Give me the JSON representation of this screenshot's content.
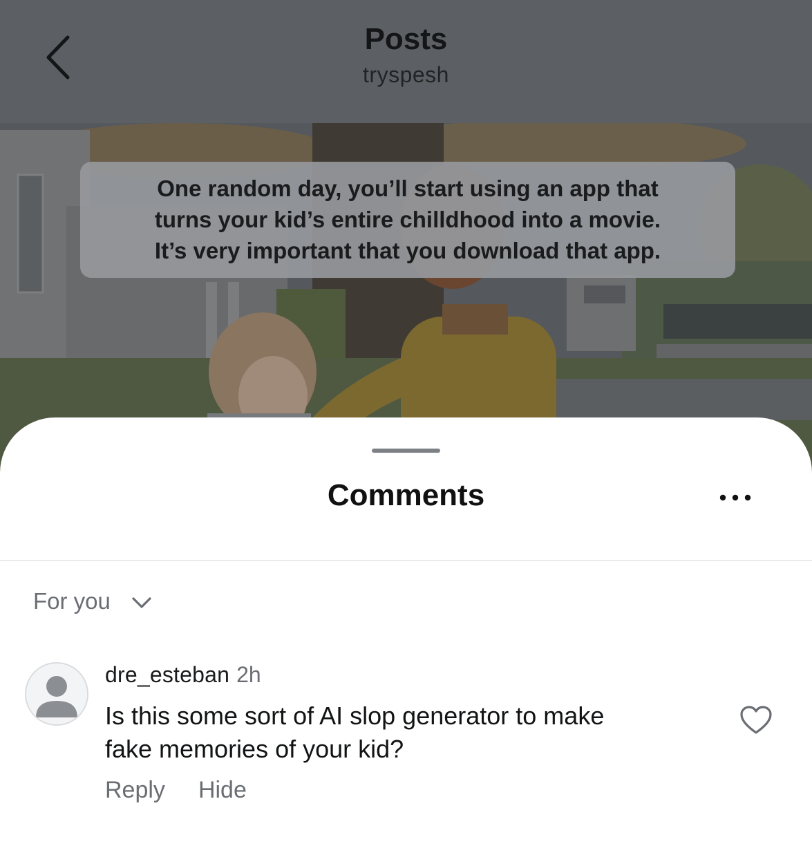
{
  "header": {
    "title": "Posts",
    "subtitle": "tryspesh",
    "back_icon": "chevron-left-icon"
  },
  "post": {
    "caption_lines": [
      "One random day, you’ll start using an app that",
      "turns your kid’s entire chilldhood into a movie.",
      "It’s very important that you download that app."
    ]
  },
  "comments_sheet": {
    "title": "Comments",
    "more_icon": "more-dots-icon",
    "sort_label": "For you",
    "sort_icon": "chevron-down-icon",
    "comments": [
      {
        "username": "dre_esteban",
        "time": "2h",
        "text_lines": [
          "Is this some sort of AI slop generator to make",
          "fake memories of your kid?"
        ],
        "reply_label": "Reply",
        "hide_label": "Hide",
        "like_icon": "heart-outline-icon",
        "avatar_icon": "default-avatar-icon"
      }
    ]
  },
  "colors": {
    "overlay_header": "#5c6064",
    "sheet_background": "#ffffff",
    "muted_text": "#6a6e73"
  }
}
